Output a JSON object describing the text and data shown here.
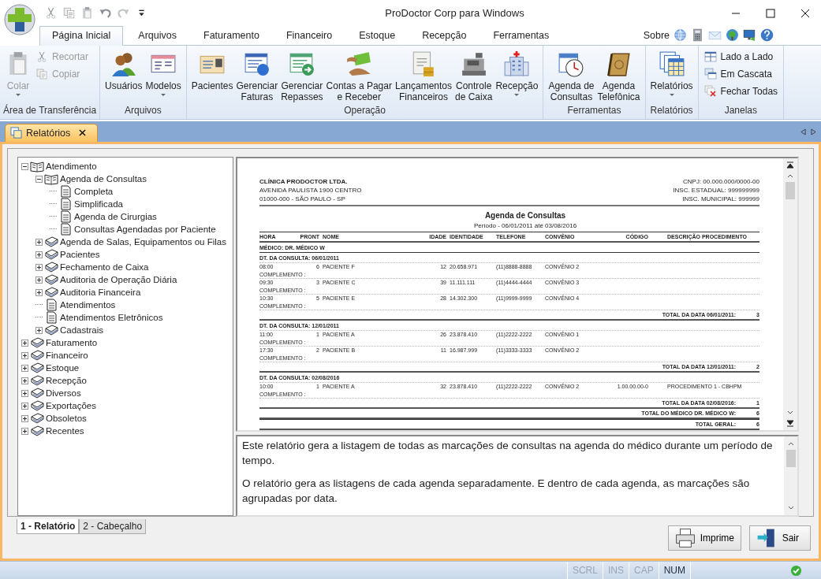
{
  "window": {
    "title": "ProDoctor Corp para Windows"
  },
  "menu_tabs": [
    {
      "label": "Página Inicial",
      "selected": true
    },
    {
      "label": "Arquivos",
      "selected": false
    },
    {
      "label": "Faturamento",
      "selected": false
    },
    {
      "label": "Financeiro",
      "selected": false
    },
    {
      "label": "Estoque",
      "selected": false
    },
    {
      "label": "Recepção",
      "selected": false
    },
    {
      "label": "Ferramentas",
      "selected": false
    }
  ],
  "about_link": "Sobre",
  "ribbon": [
    {
      "label": "Área de Transferência",
      "items": [
        {
          "kind": "large",
          "label": "Colar",
          "disabled": true,
          "dropdown": true
        },
        {
          "kind": "small",
          "label": "Recortar",
          "disabled": true
        },
        {
          "kind": "small",
          "label": "Copiar",
          "disabled": true
        }
      ]
    },
    {
      "label": "Arquivos",
      "items": [
        {
          "kind": "large",
          "label": "Usuários",
          "disabled": false,
          "dropdown": false
        },
        {
          "kind": "large",
          "label": "Modelos",
          "disabled": false,
          "dropdown": true
        }
      ]
    },
    {
      "label": "Operação",
      "items": [
        {
          "kind": "large",
          "label": "Pacientes",
          "disabled": false,
          "dropdown": false
        },
        {
          "kind": "large",
          "label": "Gerenciar\nFaturas",
          "disabled": false,
          "dropdown": false
        },
        {
          "kind": "large",
          "label": "Gerenciar\nRepasses",
          "disabled": false,
          "dropdown": false
        },
        {
          "kind": "large",
          "label": "Contas a Pagar\ne Receber",
          "disabled": false,
          "dropdown": false
        },
        {
          "kind": "large",
          "label": "Lançamentos\nFinanceiros",
          "disabled": false,
          "dropdown": false
        },
        {
          "kind": "large",
          "label": "Controle\nde Caixa",
          "disabled": false,
          "dropdown": false
        },
        {
          "kind": "large",
          "label": "Recepção",
          "disabled": false,
          "dropdown": true
        }
      ]
    },
    {
      "label": "Ferramentas",
      "items": [
        {
          "kind": "large",
          "label": "Agenda de\nConsultas",
          "disabled": false,
          "dropdown": false
        },
        {
          "kind": "large",
          "label": "Agenda\nTelefônica",
          "disabled": false,
          "dropdown": false
        }
      ]
    },
    {
      "label": "Relatórios",
      "items": [
        {
          "kind": "large",
          "label": "Relatórios",
          "disabled": false,
          "dropdown": true
        }
      ]
    },
    {
      "label": "Janelas",
      "items": [
        {
          "kind": "small",
          "label": "Lado a Lado",
          "disabled": false
        },
        {
          "kind": "small",
          "label": "Em Cascata",
          "disabled": false
        },
        {
          "kind": "small",
          "label": "Fechar Todas",
          "disabled": false
        }
      ]
    }
  ],
  "document_tab": {
    "label": "Relatórios",
    "selected": true
  },
  "tree": [
    {
      "label": "Atendimento",
      "kind": "folder",
      "expanded": true,
      "children": [
        {
          "label": "Agenda de Consultas",
          "kind": "folder",
          "expanded": true,
          "children": [
            {
              "label": "Completa",
              "kind": "report"
            },
            {
              "label": "Simplificada",
              "kind": "report"
            },
            {
              "label": "Agenda de Cirurgias",
              "kind": "report"
            },
            {
              "label": "Consultas Agendadas por Paciente",
              "kind": "report"
            }
          ]
        },
        {
          "label": "Agenda de Salas, Equipamentos ou Filas",
          "kind": "folder",
          "expanded": false
        },
        {
          "label": "Pacientes",
          "kind": "folder",
          "expanded": false
        },
        {
          "label": "Fechamento de Caixa",
          "kind": "folder",
          "expanded": false
        },
        {
          "label": "Auditoria de Operação Diária",
          "kind": "folder",
          "expanded": false
        },
        {
          "label": "Auditoria Financeira",
          "kind": "folder",
          "expanded": false
        },
        {
          "label": "Atendimentos",
          "kind": "report"
        },
        {
          "label": "Atendimentos Eletrônicos",
          "kind": "report"
        },
        {
          "label": "Cadastrais",
          "kind": "folder",
          "expanded": false
        }
      ]
    },
    {
      "label": "Faturamento",
      "kind": "folder",
      "expanded": false
    },
    {
      "label": "Financeiro",
      "kind": "folder",
      "expanded": false
    },
    {
      "label": "Estoque",
      "kind": "folder",
      "expanded": false
    },
    {
      "label": "Recepção",
      "kind": "folder",
      "expanded": false
    },
    {
      "label": "Diversos",
      "kind": "folder",
      "expanded": false
    },
    {
      "label": "Exportações",
      "kind": "folder",
      "expanded": false
    },
    {
      "label": "Obsoletos",
      "kind": "folder",
      "expanded": false
    },
    {
      "label": "Recentes",
      "kind": "folder",
      "expanded": false
    }
  ],
  "report": {
    "company": [
      "CLÍNICA PRODOCTOR LTDA.",
      "AVENIDA PAULISTA 1900 CENTRO",
      "01000-000 - SÃO PAULO - SP"
    ],
    "registrations": [
      "CNPJ: 00.000.000/0000-00",
      "INSC. ESTADUAL: 999999999",
      "INSC. MUNICIPAL: 999999"
    ],
    "title": "Agenda de Consultas",
    "period": "Período - 06/01/2011 até 03/08/2016",
    "columns": [
      "HORA",
      "PRONT",
      "NOME",
      "IDADE",
      "IDENTIDADE",
      "TELEFONE",
      "CONVÊNIO",
      "CÓDIGO",
      "DESCRIÇÃO PROCEDIMENTO"
    ],
    "doctor": "MÉDICO: DR. MÉDICO W",
    "groups": [
      {
        "heading": "DT. DA CONSULTA: 06/01/2011",
        "rows": [
          {
            "hora": "08:00",
            "pront": "6",
            "nome": "PACIENTE F",
            "idade": "12",
            "identidade": "20.658.971",
            "telefone": "(11)8888-8888",
            "convenio": "CONVÊNIO 2",
            "complemento": "COMPLEMENTO :"
          },
          {
            "hora": "09:30",
            "pront": "3",
            "nome": "PACIENTE C",
            "idade": "39",
            "identidade": "11.111.111",
            "telefone": "(11)4444-4444",
            "convenio": "CONVÊNIO 3",
            "complemento": "COMPLEMENTO :"
          },
          {
            "hora": "10:30",
            "pront": "5",
            "nome": "PACIENTE E",
            "idade": "28",
            "identidade": "14.302.300",
            "telefone": "(11)9999-9999",
            "convenio": "CONVÊNIO 4",
            "complemento": "COMPLEMENTO :"
          }
        ],
        "total_label": "TOTAL DA DATA 06/01/2011:",
        "total": "3"
      },
      {
        "heading": "DT. DA CONSULTA: 12/01/2011",
        "rows": [
          {
            "hora": "11:00",
            "pront": "1",
            "nome": "PACIENTE A",
            "idade": "26",
            "identidade": "23.878.410",
            "telefone": "(11)2222-2222",
            "convenio": "CONVÊNIO 1",
            "complemento": "COMPLEMENTO :"
          },
          {
            "hora": "17:30",
            "pront": "2",
            "nome": "PACIENTE B",
            "idade": "11",
            "identidade": "16.987.999",
            "telefone": "(11)3333-3333",
            "convenio": "CONVÊNIO 2",
            "complemento": "COMPLEMENTO :"
          }
        ],
        "total_label": "TOTAL DA DATA 12/01/2011:",
        "total": "2"
      },
      {
        "heading": "DT. DA CONSULTA: 02/08/2016",
        "rows": [
          {
            "hora": "10:00",
            "pront": "1",
            "nome": "PACIENTE A",
            "idade": "32",
            "identidade": "23.878.410",
            "telefone": "(11)2222-2222",
            "convenio": "CONVÊNIO 2",
            "codigo": "1.00.00.00-0",
            "descricao": "PROCEDIMENTO 1 - CBHPM",
            "complemento": "COMPLEMENTO :"
          }
        ],
        "total_label": "TOTAL DA DATA 02/08/2016:",
        "total": "1"
      }
    ],
    "doctor_total_label": "TOTAL DO MÉDICO DR. MÉDICO W:",
    "doctor_total": "6",
    "grand_total_label": "TOTAL GERAL:",
    "grand_total": "6"
  },
  "description": [
    "Este relatório gera a listagem de todas as marcações de consultas na agenda do médico durante um período de tempo.",
    "O relatório gera as listagens de cada agenda separadamente. E dentro de cada agenda, as marcações são agrupadas por data."
  ],
  "bottom_tabs": [
    {
      "label": "1 - Relatório",
      "selected": true
    },
    {
      "label": "2 - Cabeçalho",
      "selected": false
    }
  ],
  "buttons": [
    "Imprime",
    "Sair"
  ],
  "status_bar": [
    {
      "label": "SCRL",
      "on": false
    },
    {
      "label": "INS",
      "on": false
    },
    {
      "label": "CAP",
      "on": false
    },
    {
      "label": "NUM",
      "on": true
    }
  ]
}
